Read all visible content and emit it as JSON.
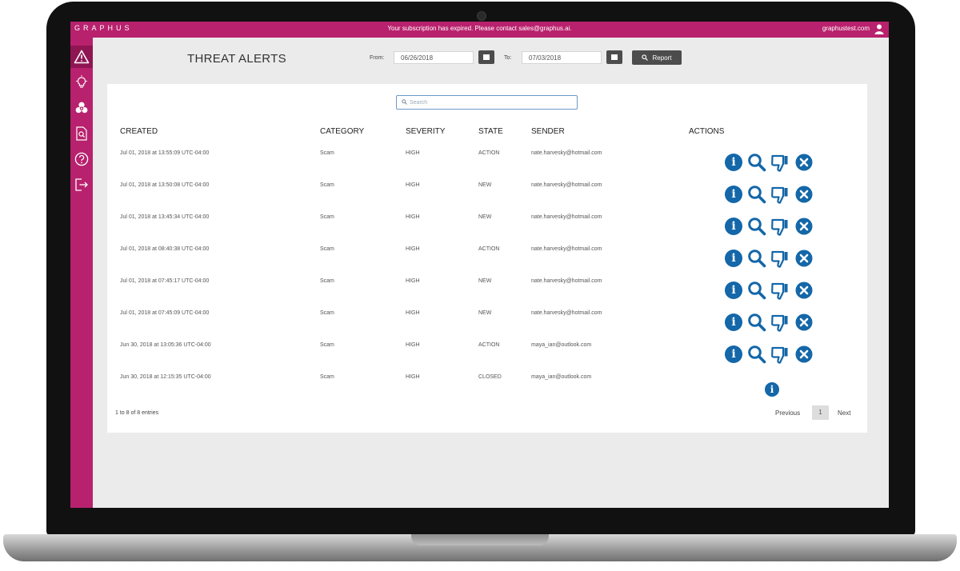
{
  "app": {
    "brand": "GRAPHUS",
    "subscription_notice": "Your subscription has expired. Please contact sales@graphus.ai.",
    "user_email": "graphustest.com",
    "accent_color": "#b8216d",
    "action_icon_color": "#1467a8"
  },
  "sidebar": {
    "items": [
      {
        "name": "threat-alerts",
        "icon": "warning-icon",
        "active": true
      },
      {
        "name": "insights",
        "icon": "lightbulb-icon",
        "active": false
      },
      {
        "name": "biohazard",
        "icon": "biohazard-icon",
        "active": false
      },
      {
        "name": "document-search",
        "icon": "document-search-icon",
        "active": false
      },
      {
        "name": "help",
        "icon": "help-icon",
        "active": false
      },
      {
        "name": "logout",
        "icon": "logout-icon",
        "active": false
      }
    ]
  },
  "header": {
    "title": "THREAT ALERTS",
    "from_label": "From:",
    "from_date": "06/26/2018",
    "to_label": "To:",
    "to_date": "07/03/2018",
    "report_label": "Report"
  },
  "table": {
    "search_placeholder": "Search",
    "columns": {
      "created": "CREATED",
      "category": "CATEGORY",
      "severity": "SEVERITY",
      "state": "STATE",
      "sender": "SENDER",
      "actions": "ACTIONS"
    },
    "rows": [
      {
        "created": "Jul 01, 2018 at 13:55:09 UTC-04:00",
        "category": "Scam",
        "severity": "HIGH",
        "state": "ACTION",
        "sender": "nate.harvesky@hotmail.com",
        "actions": [
          "info",
          "search",
          "dislike",
          "dismiss"
        ]
      },
      {
        "created": "Jul 01, 2018 at 13:50:08 UTC-04:00",
        "category": "Scam",
        "severity": "HIGH",
        "state": "NEW",
        "sender": "nate.harvesky@hotmail.com",
        "actions": [
          "info",
          "search",
          "dislike",
          "dismiss"
        ]
      },
      {
        "created": "Jul 01, 2018 at 13:45:34 UTC-04:00",
        "category": "Scam",
        "severity": "HIGH",
        "state": "NEW",
        "sender": "nate.harvesky@hotmail.com",
        "actions": [
          "info",
          "search",
          "dislike",
          "dismiss"
        ]
      },
      {
        "created": "Jul 01, 2018 at 08:40:38 UTC-04:00",
        "category": "Scam",
        "severity": "HIGH",
        "state": "ACTION",
        "sender": "nate.harvesky@hotmail.com",
        "actions": [
          "info",
          "search",
          "dislike",
          "dismiss"
        ]
      },
      {
        "created": "Jul 01, 2018 at 07:45:17 UTC-04:00",
        "category": "Scam",
        "severity": "HIGH",
        "state": "NEW",
        "sender": "nate.harvesky@hotmail.com",
        "actions": [
          "info",
          "search",
          "dislike",
          "dismiss"
        ]
      },
      {
        "created": "Jul 01, 2018 at 07:45:09 UTC-04:00",
        "category": "Scam",
        "severity": "HIGH",
        "state": "NEW",
        "sender": "nate.harvesky@hotmail.com",
        "actions": [
          "info",
          "search",
          "dislike",
          "dismiss"
        ]
      },
      {
        "created": "Jun 30, 2018 at 13:05:36 UTC-04:00",
        "category": "Scam",
        "severity": "HIGH",
        "state": "ACTION",
        "sender": "maya_ian@outlook.com",
        "actions": [
          "info",
          "search",
          "dislike",
          "dismiss"
        ]
      },
      {
        "created": "Jun 30, 2018 at 12:15:35 UTC-04:00",
        "category": "Scam",
        "severity": "HIGH",
        "state": "CLOSED",
        "sender": "maya_ian@outlook.com",
        "actions": [
          "info"
        ]
      }
    ],
    "entries_info": "1 to 8 of 8 entries",
    "pagination": {
      "previous": "Previous",
      "current_page": "1",
      "next": "Next"
    }
  }
}
